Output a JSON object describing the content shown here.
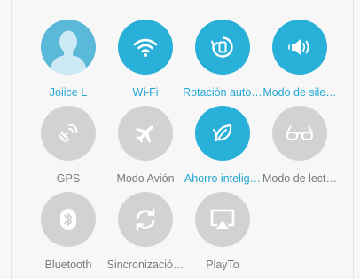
{
  "quick_settings": {
    "tiles": [
      {
        "label": "Joiice L",
        "icon": "avatar-icon",
        "active": true
      },
      {
        "label": "Wi-Fi",
        "icon": "wifi-icon",
        "active": true
      },
      {
        "label": "Rotación auto…",
        "icon": "auto-rotate-icon",
        "active": true
      },
      {
        "label": "Modo de sile…",
        "icon": "vibrate-speaker-icon",
        "active": true
      },
      {
        "label": "GPS",
        "icon": "gps-satellite-icon",
        "active": false
      },
      {
        "label": "Modo Avión",
        "icon": "airplane-icon",
        "active": false
      },
      {
        "label": "Ahorro intelig…",
        "icon": "leaf-icon",
        "active": true
      },
      {
        "label": "Modo de lect…",
        "icon": "reading-glasses-icon",
        "active": false
      },
      {
        "label": "Bluetooth",
        "icon": "bluetooth-icon",
        "active": false
      },
      {
        "label": "Sincronizació…",
        "icon": "sync-icon",
        "active": false
      },
      {
        "label": "PlayTo",
        "icon": "playto-screen-icon",
        "active": false
      }
    ]
  },
  "colors": {
    "active": "#29b0d8",
    "inactive": "#d2d2d2",
    "active_label": "#23a7d3",
    "inactive_label": "#7a7a7a"
  }
}
